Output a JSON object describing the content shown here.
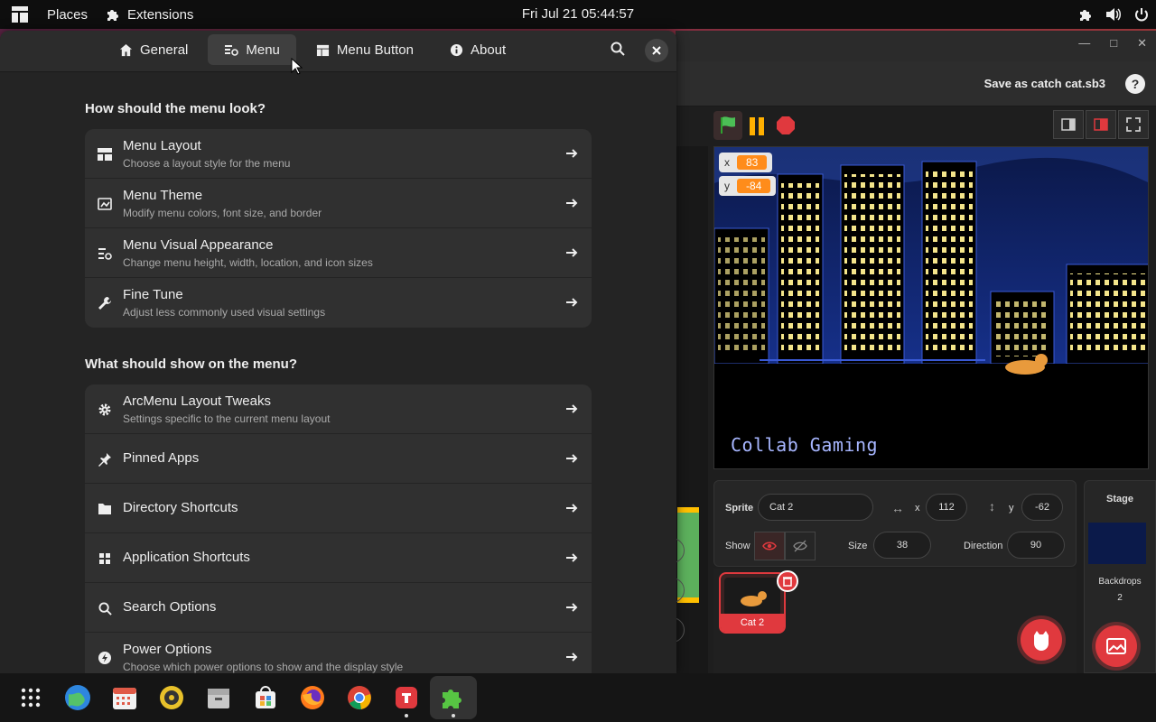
{
  "topbar": {
    "apps_icon": "activities-grid-icon",
    "places_label": "Places",
    "extensions_label": "Extensions",
    "clock": "Fri Jul 21  05:44:57"
  },
  "settings": {
    "tabs": [
      {
        "label": "General",
        "icon": "home-icon"
      },
      {
        "label": "Menu",
        "icon": "menu-settings-icon"
      },
      {
        "label": "Menu Button",
        "icon": "menu-button-icon"
      },
      {
        "label": "About",
        "icon": "info-icon"
      }
    ],
    "active_tab": "Menu",
    "section1_title": "How should the menu look?",
    "section2_title": "What should show on the menu?",
    "look_rows": [
      {
        "title": "Menu Layout",
        "subtitle": "Choose a layout style for the menu",
        "icon": "layout-icon"
      },
      {
        "title": "Menu Theme",
        "subtitle": "Modify menu colors, font size, and border",
        "icon": "theme-icon"
      },
      {
        "title": "Menu Visual Appearance",
        "subtitle": "Change menu height, width, location, and icon sizes",
        "icon": "appearance-icon"
      },
      {
        "title": "Fine Tune",
        "subtitle": "Adjust less commonly used visual settings",
        "icon": "wrench-icon"
      }
    ],
    "show_rows": [
      {
        "title": "ArcMenu Layout Tweaks",
        "subtitle": "Settings specific to the current menu layout",
        "icon": "gear-icon"
      },
      {
        "title": "Pinned Apps",
        "subtitle": "",
        "icon": "pin-icon"
      },
      {
        "title": "Directory Shortcuts",
        "subtitle": "",
        "icon": "folder-icon"
      },
      {
        "title": "Application Shortcuts",
        "subtitle": "",
        "icon": "grid-icon"
      },
      {
        "title": "Search Options",
        "subtitle": "",
        "icon": "search-icon"
      },
      {
        "title": "Power Options",
        "subtitle": "Choose which power options to show and the display style",
        "icon": "power-icon"
      }
    ]
  },
  "scratch": {
    "save_label": "Save as catch cat.sb3",
    "help_label": "?",
    "monitor_x_label": "x",
    "monitor_x_value": "83",
    "monitor_y_label": "y",
    "monitor_y_value": "-84",
    "stage_text": "Collab Gaming",
    "sprite_label": "Sprite",
    "sprite_name": "Cat 2",
    "x_label": "x",
    "x_value": "112",
    "y_label": "y",
    "y_value": "-62",
    "show_label": "Show",
    "size_label": "Size",
    "size_value": "38",
    "direction_label": "Direction",
    "direction_value": "90",
    "tile_name": "Cat 2",
    "stage_label": "Stage",
    "backdrops_label": "Backdrops",
    "backdrops_count": "2"
  },
  "dock": {
    "apps": [
      "app-grid-icon",
      "browser-globe-icon",
      "calendar-icon",
      "music-player-icon",
      "file-archive-icon",
      "software-store-icon",
      "firefox-icon",
      "chrome-icon",
      "scratch-app-icon",
      "extensions-puzzle-icon"
    ]
  },
  "colors": {
    "accent_red": "#e0393e",
    "scratch_orange": "#ff8c1a",
    "panel_bg": "#242424",
    "row_bg": "#303030"
  }
}
